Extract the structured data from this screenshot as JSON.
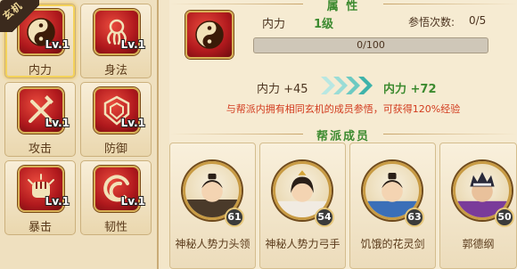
{
  "corner_tag": "玄机",
  "skills": [
    {
      "name": "内力",
      "level": "Lv.1",
      "icon": "yin-yang-icon"
    },
    {
      "name": "身法",
      "level": "Lv.1",
      "icon": "octopus-icon"
    },
    {
      "name": "攻击",
      "level": "Lv.1",
      "icon": "crossed-swords-icon"
    },
    {
      "name": "防御",
      "level": "Lv.1",
      "icon": "shield-icon"
    },
    {
      "name": "暴击",
      "level": "Lv.1",
      "icon": "fist-icon"
    },
    {
      "name": "韧性",
      "level": "Lv.1",
      "icon": "swirl-icon"
    }
  ],
  "attribute": {
    "section_title": "属 性",
    "name": "内力",
    "level": "1级",
    "insight_label": "参悟次数:",
    "insight_value": "0/5",
    "progress_text": "0/100",
    "progress_fraction": 0,
    "bonus_from": "内力 +45",
    "bonus_to": "内力 +72",
    "hint": "与帮派内拥有相同玄机的成员参悟，可获得120%经验"
  },
  "members": {
    "section_title": "帮派成员",
    "list": [
      {
        "name": "神秘人势力头领",
        "level": "61"
      },
      {
        "name": "神秘人势力弓手",
        "level": "54"
      },
      {
        "name": "饥饿的花灵剑",
        "level": "63"
      },
      {
        "name": "郭德纲",
        "level": "50"
      }
    ]
  },
  "colors": {
    "accent_green": "#3c8a2f",
    "hint_red": "#d23b1e",
    "icon_red": "#b0191d"
  }
}
